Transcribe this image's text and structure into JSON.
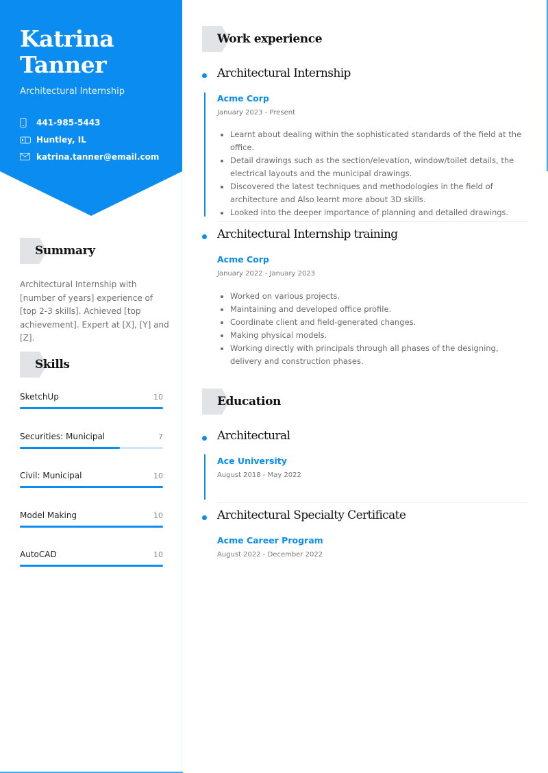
{
  "colors": {
    "accent": "#0a8cf0",
    "hero_bg": "#0a8cf0",
    "tag_bg": "#e1e4e6",
    "track": "#cfe6fb"
  },
  "profile": {
    "first_name": "Katrina",
    "last_name": "Tanner",
    "role": "Architectural Internship",
    "contact": [
      {
        "icon": "phone-icon",
        "text": "441-985-5443"
      },
      {
        "icon": "location-icon",
        "text": "Huntley, IL"
      },
      {
        "icon": "email-icon",
        "text": "katrina.tanner@email.com"
      }
    ]
  },
  "summary": {
    "heading": "Summary",
    "text": "Architectural Internship with [number of years] experience of [top 2-3 skills]. Achieved [top achievement]. Expert at [X], [Y] and [Z]."
  },
  "skills": {
    "heading": "Skills",
    "max": 10,
    "items": [
      {
        "name": "SketchUp",
        "value": 10
      },
      {
        "name": "Securities: Municipal",
        "value": 7
      },
      {
        "name": "Civil: Municipal",
        "value": 10
      },
      {
        "name": "Model Making",
        "value": 10
      },
      {
        "name": "AutoCAD",
        "value": 10
      }
    ]
  },
  "work": {
    "heading": "Work experience",
    "items": [
      {
        "title": "Architectural Internship",
        "org": "Acme Corp",
        "date": "January 2023 - Present",
        "bullets": [
          "Learnt about dealing within the sophisticated standards of the field at the office.",
          "Detail drawings such as the section/elevation, window/toilet details, the electrical layouts and the municipal drawings.",
          "Discovered the latest techniques and methodologies in the field of architecture and Also learnt more about 3D skills.",
          "Looked into the deeper importance of planning and detailed drawings."
        ]
      },
      {
        "title": "Architectural Internship training",
        "org": "Acme Corp",
        "date": "January 2022 - January 2023",
        "bullets": [
          "Worked on various projects.",
          "Maintaining and developed office profile.",
          "Coordinate client and field-generated changes.",
          "Making physical models.",
          "Working directly with principals through all phases of the designing, delivery and construction phases."
        ]
      }
    ]
  },
  "education": {
    "heading": "Education",
    "items": [
      {
        "title": "Architectural",
        "org": "Ace University",
        "date": "August 2018 - May 2022"
      },
      {
        "title": "Architectural Specialty Certificate",
        "org": "Acme Career Program",
        "date": "August 2022 - December 2022"
      }
    ]
  }
}
